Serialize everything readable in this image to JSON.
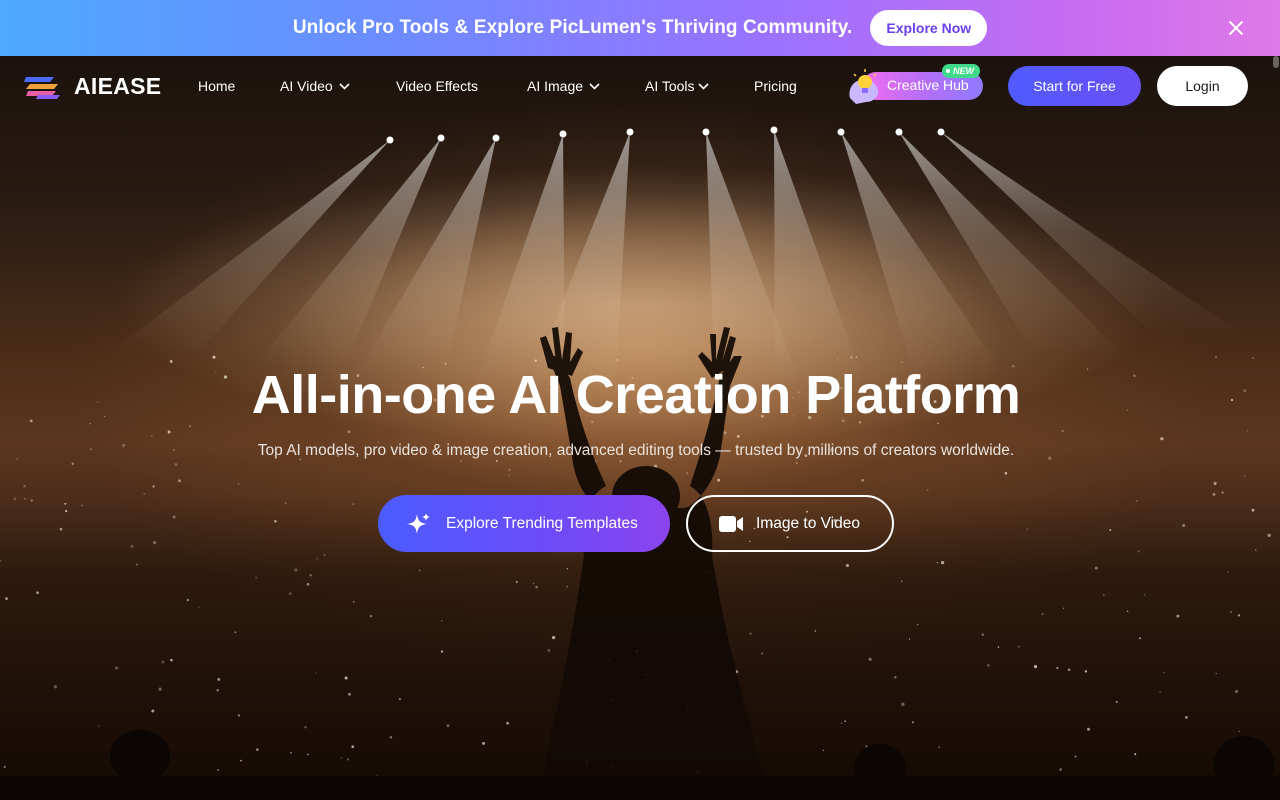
{
  "promo": {
    "text": "Unlock Pro Tools & Explore PicLumen's Thriving Community.",
    "button_label": "Explore Now",
    "close_icon": "close-icon"
  },
  "nav": {
    "logo_text": "AIEASE",
    "items": [
      {
        "label": "Home",
        "has_dropdown": false
      },
      {
        "label": "AI Video",
        "has_dropdown": true
      },
      {
        "label": "Video Effects",
        "has_dropdown": false
      },
      {
        "label": "AI Image",
        "has_dropdown": true
      },
      {
        "label": "AI Tools",
        "has_dropdown": true
      },
      {
        "label": "Pricing",
        "has_dropdown": false
      }
    ],
    "creative_hub": {
      "label": "Creative Hub",
      "badge": "NEW",
      "icon": "lightbulb-icon"
    },
    "start_button": "Start for Free",
    "login_button": "Login"
  },
  "hero": {
    "title": "All-in-one AI Creation Platform",
    "subtitle": "Top AI models, pro video & image creation, advanced editing tools — trusted by millions of creators worldwide.",
    "primary_cta": {
      "label": "Explore Trending Templates",
      "icon": "sparkle-icon"
    },
    "secondary_cta": {
      "label": "Image to Video",
      "icon": "video-camera-icon"
    }
  },
  "colors": {
    "primary_gradient_start": "#4b5cff",
    "primary_gradient_end": "#8b44ee",
    "promo_gradient_start": "#4ea9ff",
    "promo_gradient_end": "#e079e9",
    "new_badge": "#3fd98a"
  }
}
